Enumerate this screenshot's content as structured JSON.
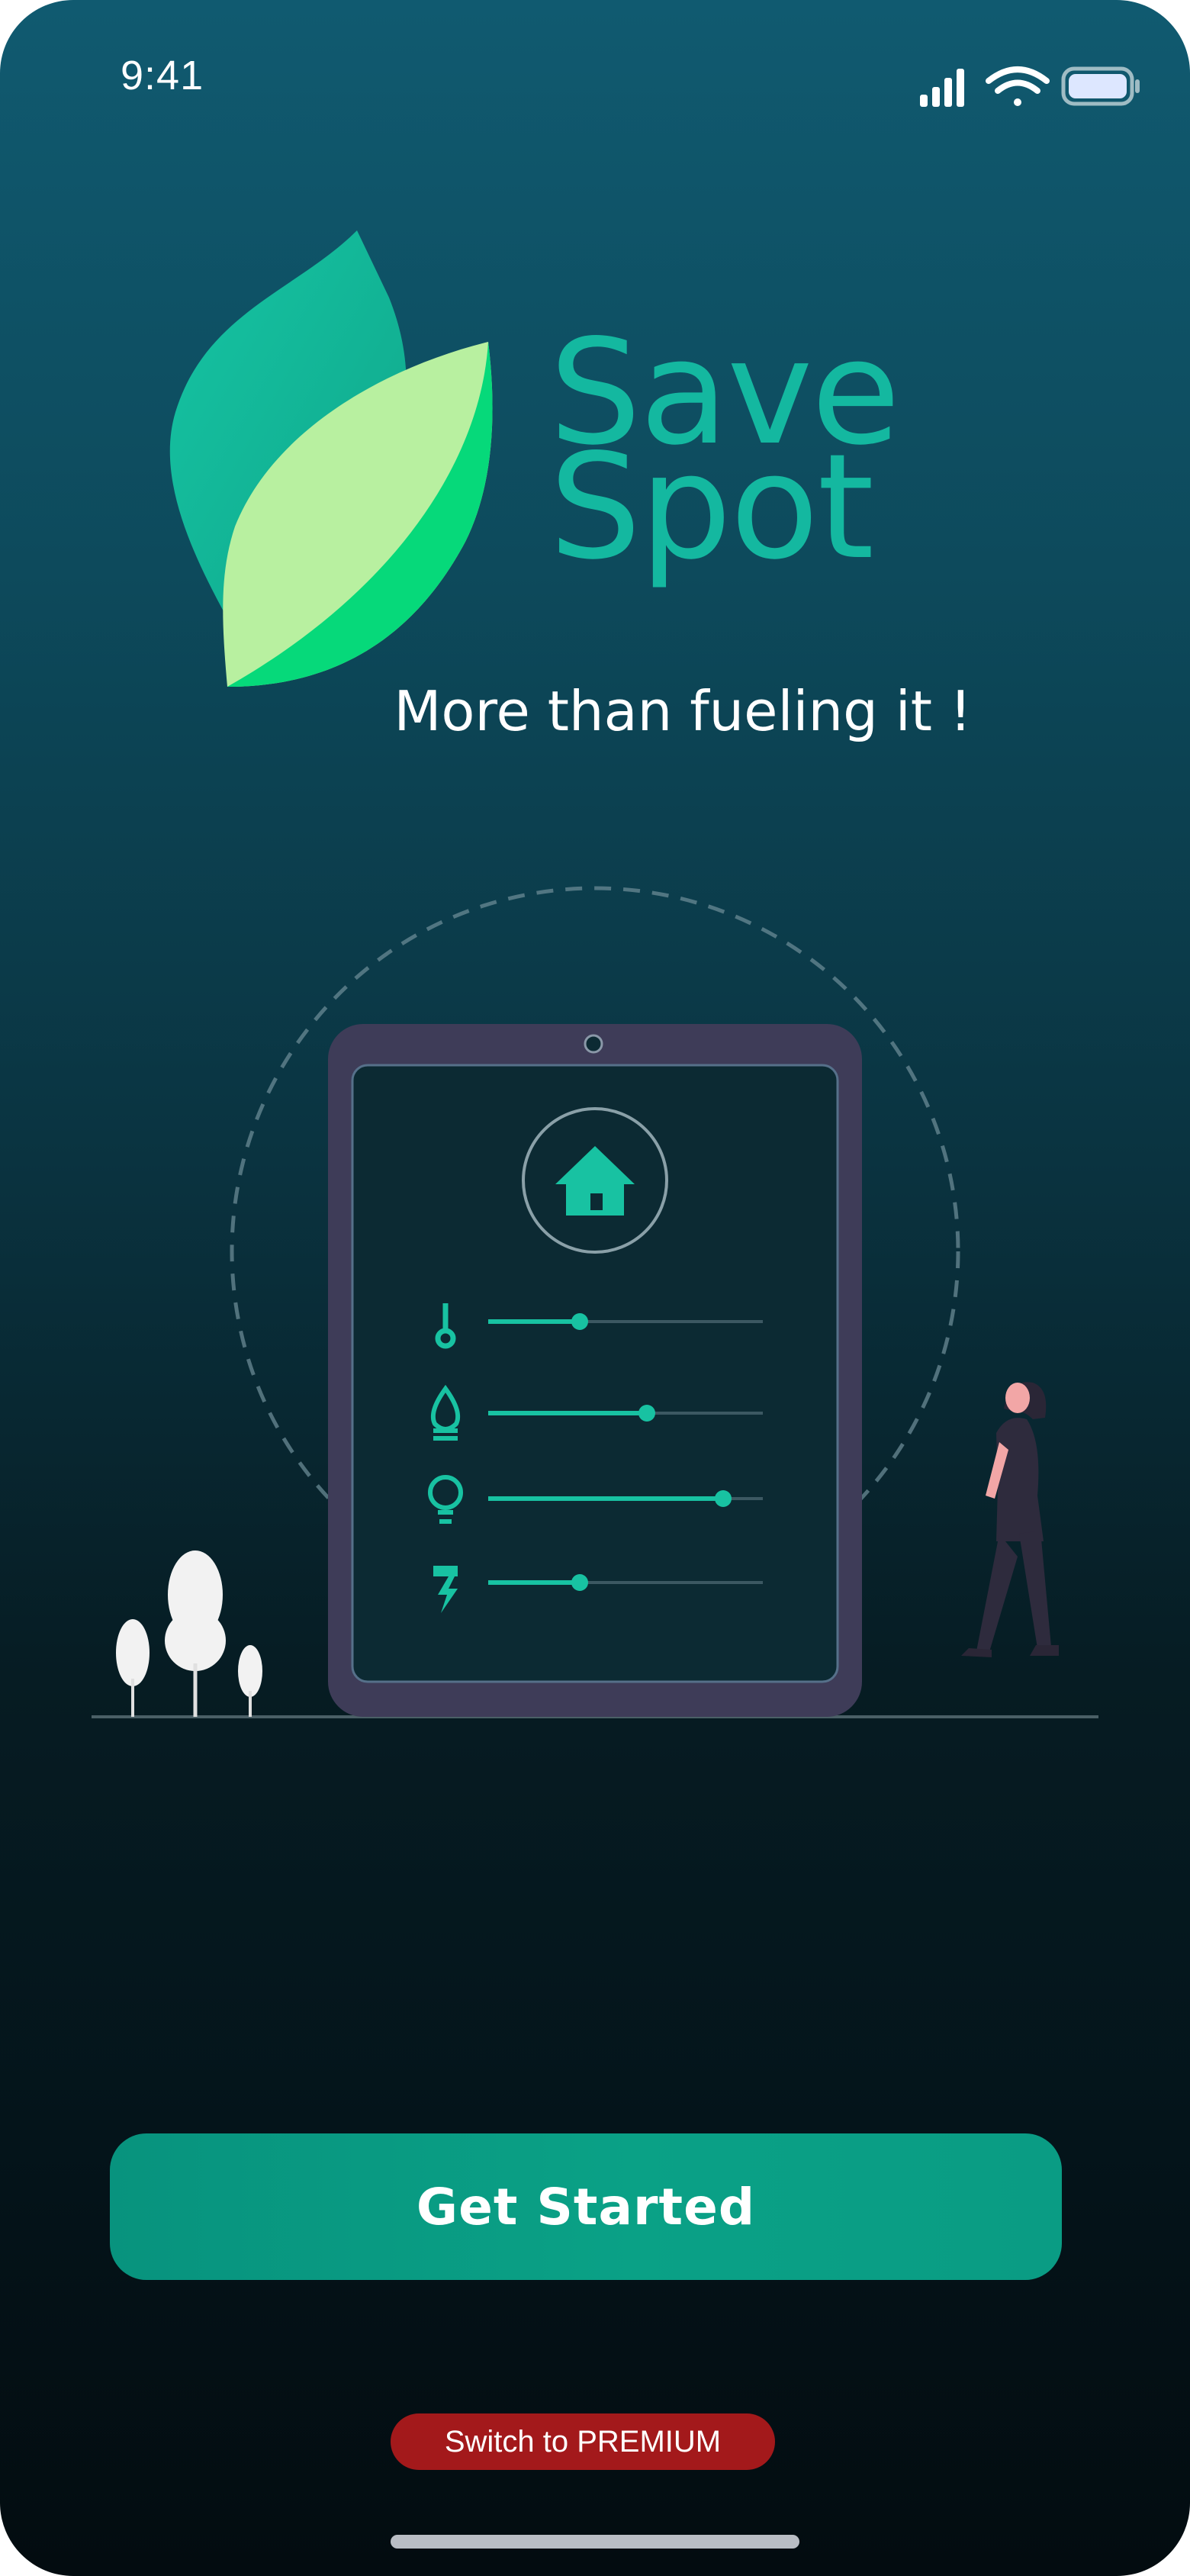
{
  "status_bar": {
    "time": "9:41",
    "icons": [
      "signal-icon",
      "wifi-icon",
      "battery-icon"
    ]
  },
  "brand": {
    "name_line1": "Save",
    "name_line2": "Spot",
    "tagline": "More than fueling it !",
    "logo": "leaf-logo"
  },
  "illustration": {
    "icons": [
      "home-icon",
      "thermometer-icon",
      "fuel-drop-icon",
      "lightbulb-icon",
      "power-plug-icon"
    ],
    "sliders": [
      {
        "name": "temperature",
        "level": 0.33
      },
      {
        "name": "fuel",
        "level": 0.58
      },
      {
        "name": "light",
        "level": 0.86
      },
      {
        "name": "power",
        "level": 0.33
      }
    ]
  },
  "actions": {
    "get_started": "Get Started",
    "premium": "Switch to PREMIUM"
  },
  "colors": {
    "accent": "#0aa186",
    "brand_text": "#14b8a0",
    "premium": "#a3191b"
  }
}
